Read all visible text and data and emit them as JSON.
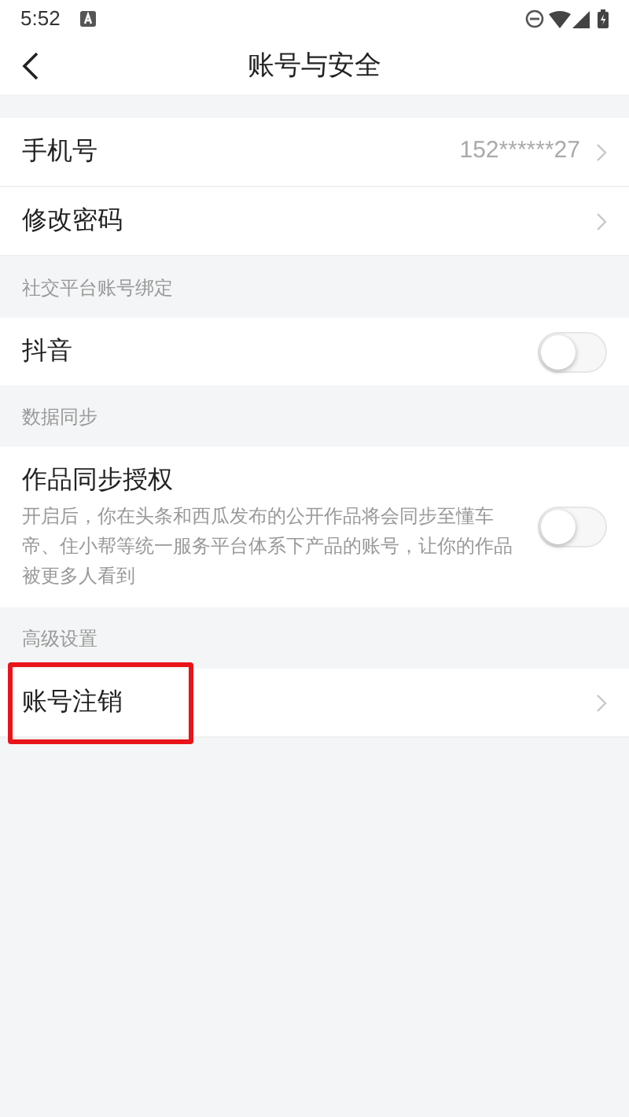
{
  "status_bar": {
    "time": "5:52"
  },
  "header": {
    "title": "账号与安全"
  },
  "sections": [
    {
      "rows": [
        {
          "kind": "link",
          "label": "手机号",
          "value": "152******27",
          "highlighted": false
        },
        {
          "kind": "link",
          "label": "修改密码",
          "highlighted": false
        }
      ]
    },
    {
      "heading": "社交平台账号绑定",
      "rows": [
        {
          "kind": "switch",
          "label": "抖音",
          "on": false
        }
      ]
    },
    {
      "heading": "数据同步",
      "rows": [
        {
          "kind": "switch",
          "label": "作品同步授权",
          "description": "开启后，你在头条和西瓜发布的公开作品将会同步至懂车帝、住小帮等统一服务平台体系下产品的账号，让你的作品被更多人看到",
          "on": false
        }
      ]
    },
    {
      "heading": "高级设置",
      "rows": [
        {
          "kind": "link",
          "label": "账号注销",
          "highlighted": true
        }
      ]
    }
  ]
}
